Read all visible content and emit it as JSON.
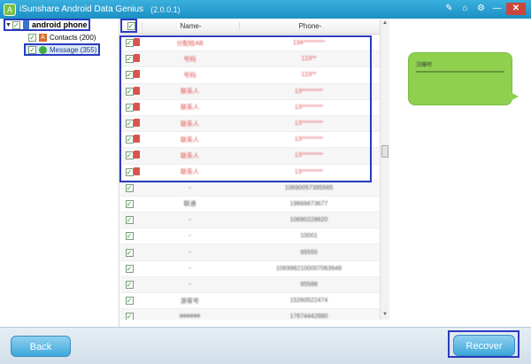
{
  "app": {
    "title": "iSunshare Android Data Genius",
    "version": "(2.0.0.1)",
    "controls": {
      "pin": "✎",
      "home": "⌂",
      "settings": "⚙",
      "minimize": "—",
      "close": "✕"
    }
  },
  "tree": {
    "root_label": "android phone",
    "items": [
      {
        "label": "Contacts (200)"
      },
      {
        "label": "Message (355)"
      }
    ]
  },
  "table": {
    "col_name": "Name-",
    "col_phone": "Phone-",
    "rows": [
      {
        "deleted": true,
        "name": "分配给AB",
        "phone": "134*********"
      },
      {
        "deleted": true,
        "name": "号码",
        "phone": "123**"
      },
      {
        "deleted": true,
        "name": "号码",
        "phone": "123**"
      },
      {
        "deleted": true,
        "name": "联系人",
        "phone": "13*********"
      },
      {
        "deleted": true,
        "name": "联系人",
        "phone": "13*********"
      },
      {
        "deleted": true,
        "name": "联系人",
        "phone": "13*********"
      },
      {
        "deleted": true,
        "name": "联系人",
        "phone": "13*********"
      },
      {
        "deleted": true,
        "name": "联系人",
        "phone": "13*********"
      },
      {
        "deleted": true,
        "name": "联系人",
        "phone": "13*********"
      },
      {
        "deleted": false,
        "name": "-",
        "phone": "10690057395565"
      },
      {
        "deleted": false,
        "name": "联通",
        "phone": "19666673677"
      },
      {
        "deleted": false,
        "name": "-",
        "phone": "10690228620"
      },
      {
        "deleted": false,
        "name": "-",
        "phone": "10001"
      },
      {
        "deleted": false,
        "name": "-",
        "phone": "95555"
      },
      {
        "deleted": false,
        "name": "-",
        "phone": "1069982100007063948"
      },
      {
        "deleted": false,
        "name": "-",
        "phone": "95588"
      },
      {
        "deleted": false,
        "name": "游客号",
        "phone": "15260522474"
      },
      {
        "deleted": false,
        "name": "######",
        "phone": "17674442880"
      }
    ]
  },
  "preview": {
    "message_text": "沉睡吧"
  },
  "footer": {
    "back_label": "Back",
    "recover_label": "Recover"
  }
}
